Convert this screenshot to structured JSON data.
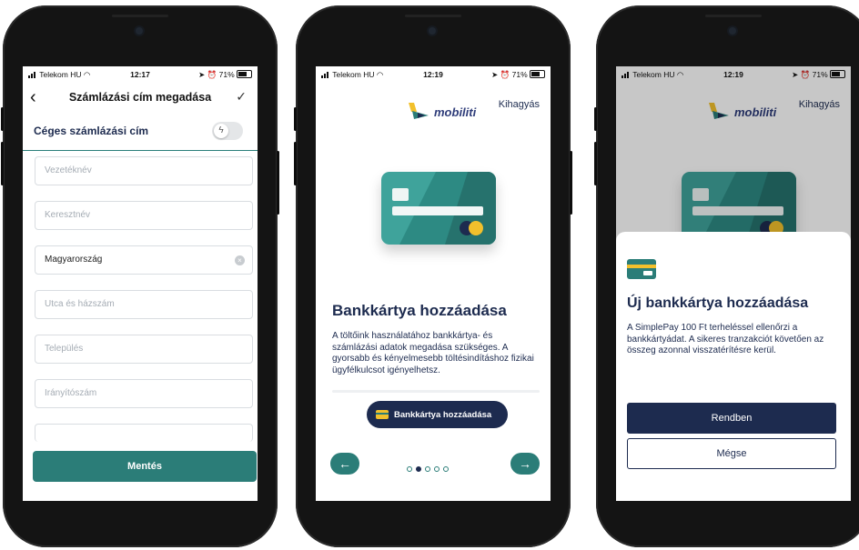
{
  "status_bars": [
    {
      "carrier": "Telekom HU",
      "time": "12:17",
      "battery": "71%"
    },
    {
      "carrier": "Telekom HU",
      "time": "12:19",
      "battery": "71%"
    },
    {
      "carrier": "Telekom HU",
      "time": "12:19",
      "battery": "71%"
    }
  ],
  "billing": {
    "title": "Számlázási cím megadása",
    "company_label": "Céges számlázási cím",
    "fields": {
      "last_name": "Vezetéknév",
      "first_name": "Keresztnév",
      "country": "Magyarország",
      "street": "Utca és házszám",
      "city": "Település",
      "zip": "Irányítószám"
    },
    "save_label": "Mentés"
  },
  "brand": {
    "name": "mobiliti",
    "colors": {
      "navy": "#1d2b4f",
      "teal": "#2b7d78",
      "yellow": "#f2c02c"
    }
  },
  "onboarding": {
    "skip_label": "Kihagyás",
    "title": "Bankkártya hozzáadása",
    "text": "A töltőink használatához bankkártya- és számlázási adatok megadása szükséges. A gyorsabb és kényelmesebb töltésindításhoz fizikai ügyfélkulcsot igényelhetsz.",
    "add_button": "Bankkártya hozzáadása",
    "prev_icon": "←",
    "next_icon": "→",
    "page_count": 5,
    "current_page": 2
  },
  "modal": {
    "title": "Új bankkártya hozzáadása",
    "text": "A SimplePay 100 Ft terheléssel ellenőrzi a bankkártyádat. A sikeres tranzakciót követően az összeg azonnal visszatérítésre kerül.",
    "ok_label": "Rendben",
    "cancel_label": "Mégse"
  }
}
